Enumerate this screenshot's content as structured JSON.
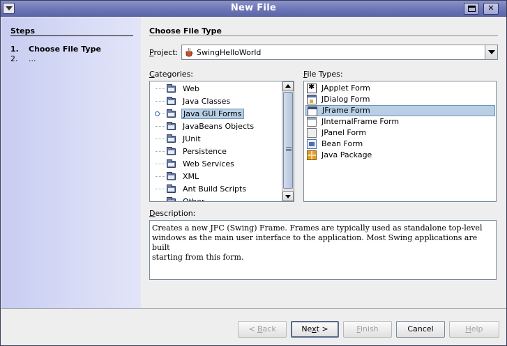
{
  "window": {
    "title": "New File"
  },
  "steps": {
    "header": "Steps",
    "items": [
      {
        "num": "1.",
        "label": "Choose File Type"
      },
      {
        "num": "2.",
        "label": "..."
      }
    ]
  },
  "main": {
    "heading": "Choose File Type",
    "project_label": "Project:",
    "project_value": "SwingHelloWorld",
    "categories_label": "Categories:",
    "categories": [
      "Web",
      "Java Classes",
      "Java GUI Forms",
      "JavaBeans Objects",
      "JUnit",
      "Persistence",
      "Web Services",
      "XML",
      "Ant Build Scripts",
      "Other"
    ],
    "selected_category": "Java GUI Forms",
    "file_types_label": "File Types:",
    "file_types": [
      {
        "label": "JApplet Form",
        "icon": "applet-form-icon"
      },
      {
        "label": "JDialog Form",
        "icon": "dialog-form-icon"
      },
      {
        "label": "JFrame Form",
        "icon": "frame-form-icon"
      },
      {
        "label": "JInternalFrame Form",
        "icon": "internal-frame-form-icon"
      },
      {
        "label": "JPanel Form",
        "icon": "panel-form-icon"
      },
      {
        "label": "Bean Form",
        "icon": "bean-form-icon"
      },
      {
        "label": "Java Package",
        "icon": "java-package-icon"
      }
    ],
    "selected_file_type": "JFrame Form",
    "description_label": "Description:",
    "description_lines": [
      "Creates a new JFC (Swing) Frame. Frames are typically used as standalone top-level",
      "windows as the main user interface to the application. Most Swing applications are built",
      "starting from this form."
    ]
  },
  "buttons": {
    "back": "< Back",
    "next": "Next >",
    "finish": "Finish",
    "cancel": "Cancel",
    "help": "Help"
  }
}
